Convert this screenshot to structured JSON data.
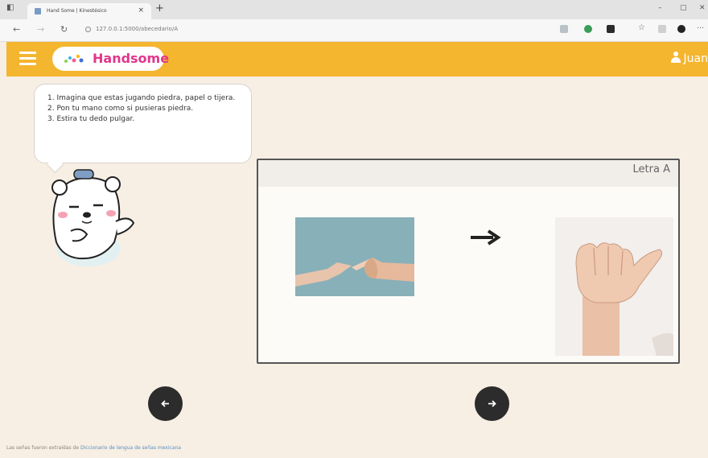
{
  "browser": {
    "tab_title": "Hand Some | Kinestésico",
    "tab_close": "×",
    "new_tab": "+",
    "url": "127.0.0.1:5000/abecedario/A",
    "window_controls": {
      "minimize": "–",
      "maximize": "▢",
      "close": "✕"
    }
  },
  "header": {
    "brand": "Handsome",
    "user": "Juan",
    "accent_color": "#f4b52f",
    "brand_color": "#e2368a"
  },
  "instructions": {
    "items": [
      "1. Imagina que estas jugando piedra, papel o tijera.",
      "2. Pon tu mano como si pusieras piedra.",
      "3. Estira tu dedo pulgar."
    ]
  },
  "card": {
    "title": "Letra A",
    "image1": "rock-paper-scissors-hands-photo",
    "image2": "letter-a-hand-sign-photo"
  },
  "nav": {
    "prev_icon": "arrow-left-icon",
    "next_icon": "arrow-right-icon"
  },
  "footer": {
    "text": "Las señas fueron extraídas de",
    "link": "Diccionario de lengua de señas mexicana"
  }
}
